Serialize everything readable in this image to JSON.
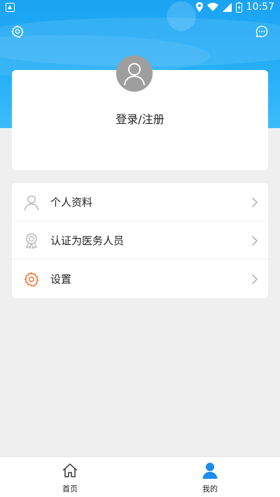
{
  "status_bar": {
    "time": "10:57"
  },
  "header": {
    "settings_icon": "gear-icon",
    "message_icon": "chat-bubble-icon"
  },
  "profile": {
    "avatar_icon": "default-avatar-icon",
    "login_label": "登录/注册"
  },
  "menu": {
    "items": [
      {
        "label": "个人资料",
        "icon": "person-icon",
        "color": "#b8b8b8"
      },
      {
        "label": "认证为医务人员",
        "icon": "badge-icon",
        "color": "#b8b8b8"
      },
      {
        "label": "设置",
        "icon": "gear-icon",
        "color": "#ef7a3c"
      }
    ]
  },
  "tabbar": {
    "tabs": [
      {
        "label": "首页",
        "icon": "home-icon",
        "active": false
      },
      {
        "label": "我的",
        "icon": "person-icon",
        "active": true
      }
    ]
  },
  "colors": {
    "header_blue": "#1aa3f2",
    "active_tab": "#1b8cf0",
    "settings_orange": "#ef7a3c"
  }
}
